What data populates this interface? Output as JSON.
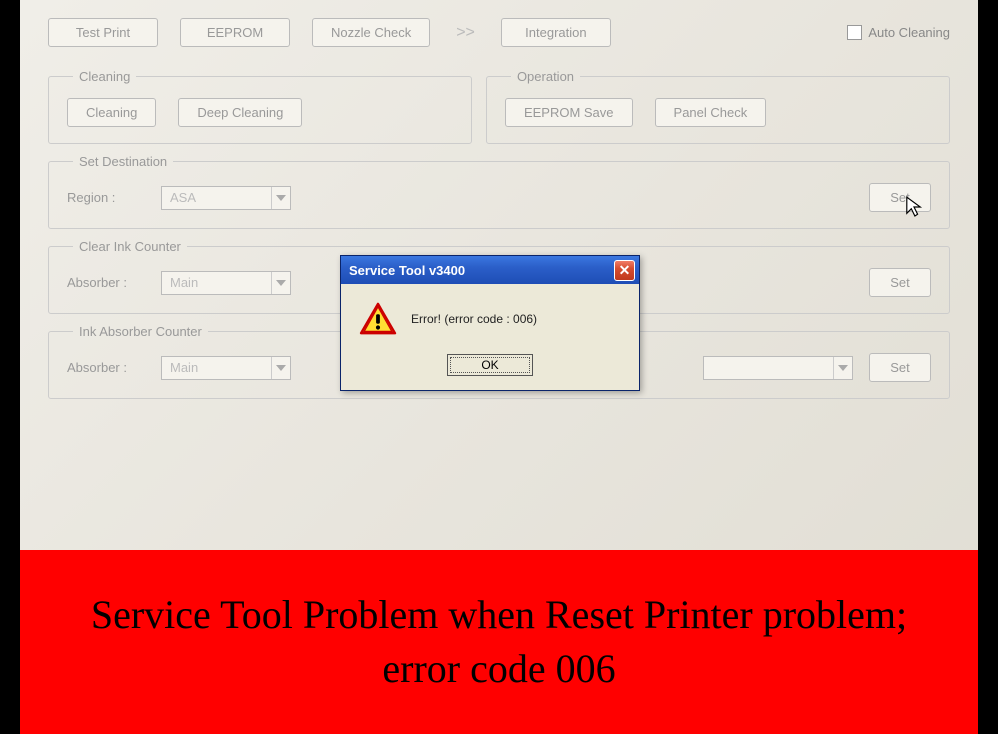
{
  "topbar": {
    "test_print": "Test Print",
    "eeprom": "EEPROM",
    "nozzle_check": "Nozzle Check",
    "integration": "Integration",
    "auto_cleaning": "Auto Cleaning"
  },
  "groups": {
    "cleaning": {
      "legend": "Cleaning",
      "cleaning_btn": "Cleaning",
      "deep_cleaning_btn": "Deep Cleaning"
    },
    "operation": {
      "legend": "Operation",
      "eeprom_save": "EEPROM Save",
      "panel_check": "Panel Check"
    },
    "set_destination": {
      "legend": "Set Destination",
      "region_label": "Region :",
      "region_value": "ASA",
      "set_btn": "Set"
    },
    "clear_ink": {
      "legend": "Clear Ink Counter",
      "absorber_label": "Absorber :",
      "absorber_value": "Main",
      "set_btn": "Set"
    },
    "ink_absorber": {
      "legend": "Ink Absorber Counter",
      "absorber_label": "Absorber :",
      "absorber_value": "Main",
      "set_btn": "Set"
    }
  },
  "dialog": {
    "title": "Service Tool v3400",
    "message": "Error! (error code : 006)",
    "ok": "OK"
  },
  "banner": {
    "text": "Service Tool Problem when Reset Printer problem; error code 006"
  }
}
